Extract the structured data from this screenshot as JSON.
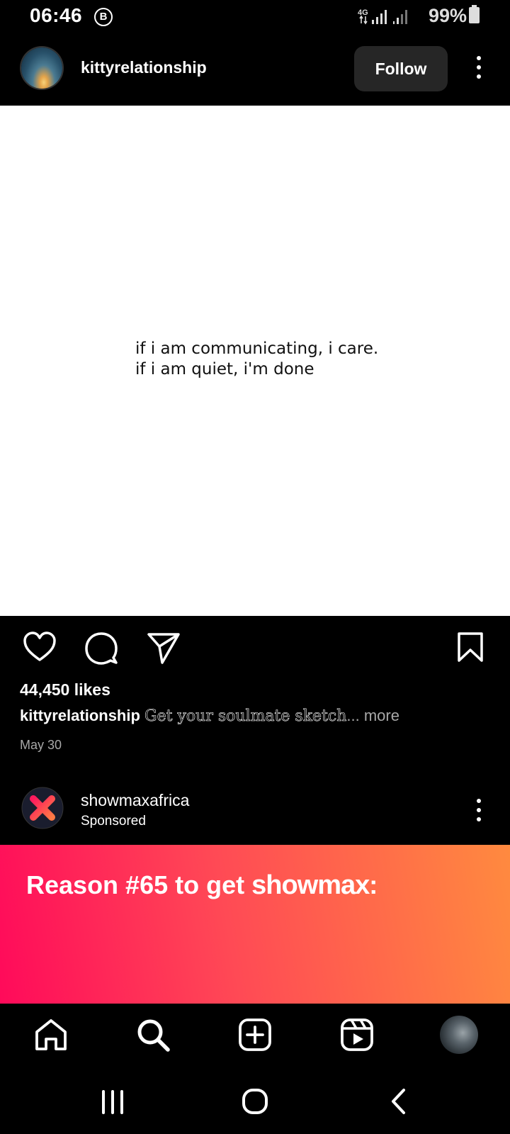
{
  "status_bar": {
    "time": "06:46",
    "b_badge": "B",
    "network": "4G",
    "battery": "99%",
    "battery_level": 0.99
  },
  "post": {
    "username": "kittyrelationship",
    "follow_label": "Follow",
    "quote_line1": "if i am communicating, i care.",
    "quote_line2": "if i am quiet, i'm done",
    "likes": "44,450 likes",
    "caption_user": "kittyrelationship",
    "caption_text": "Get your soulmate sketch",
    "caption_more": "... more",
    "date": "May 30",
    "icons": [
      "heart-icon",
      "comment-icon",
      "share-icon",
      "bookmark-icon"
    ]
  },
  "ad": {
    "username": "showmaxafrica",
    "sponsored_label": "Sponsored",
    "headline": "Reason #65 to get ",
    "brand": "showmax",
    "brand_suffix": ":",
    "colors": {
      "start": "#ff0a5a",
      "end": "#ff8a3f"
    }
  },
  "bottom_nav": {
    "items": [
      "home-icon",
      "search-icon",
      "create-icon",
      "reels-icon",
      "profile-avatar"
    ]
  },
  "system_nav": {
    "items": [
      "recents-icon",
      "home-circle-icon",
      "back-icon"
    ]
  }
}
